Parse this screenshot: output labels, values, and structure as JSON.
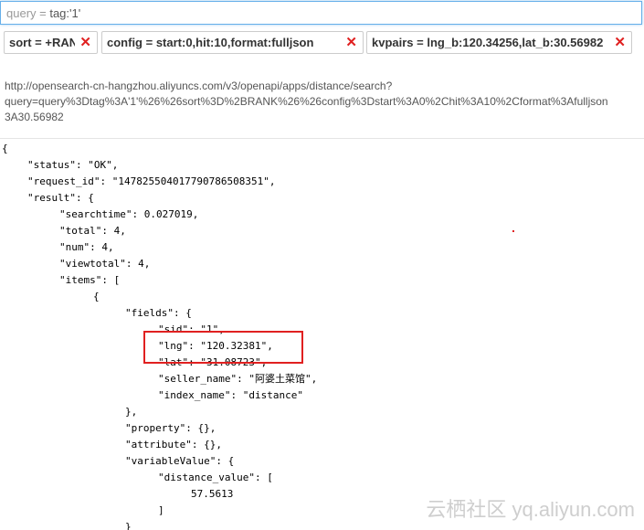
{
  "query": {
    "prefix": "query = ",
    "value": "tag:'1'"
  },
  "params": [
    {
      "label": "sort = ",
      "value": "+RANK"
    },
    {
      "label": "config = ",
      "value": "start:0,hit:10,format:fulljson"
    },
    {
      "label": "kvpairs = ",
      "value": "lng_b:120.34256,lat_b:30.56982"
    }
  ],
  "close_glyph": "✕",
  "url_lines": [
    "http://opensearch-cn-hangzhou.aliyuncs.com/v3/openapi/apps/distance/search?",
    "query=query%3Dtag%3A'1'%26%26sort%3D%2BRANK%26%26config%3Dstart%3A0%2Chit%3A10%2Cformat%3Afulljson",
    "3A30.56982"
  ],
  "json_lines": [
    "{",
    "\"status\": \"OK\",",
    "\"request_id\": \"147825504017790786508351\",",
    "\"result\": {",
    "\"searchtime\": 0.027019,",
    "\"total\": 4,",
    "\"num\": 4,",
    "\"viewtotal\": 4,",
    "\"items\": [",
    "{",
    "\"fields\": {",
    "\"sid\": \"1\",",
    "\"lng\": \"120.32381\",",
    "\"lat\": \"31.08723\",",
    "\"seller_name\": \"阿婆土菜馆\",",
    "\"index_name\": \"distance\"",
    "},",
    "\"property\": {},",
    "\"attribute\": {},",
    "\"variableValue\": {",
    "\"distance_value\": [",
    "57.5613",
    "]",
    "}"
  ],
  "watermark": "云栖社区 yq.aliyun.com"
}
